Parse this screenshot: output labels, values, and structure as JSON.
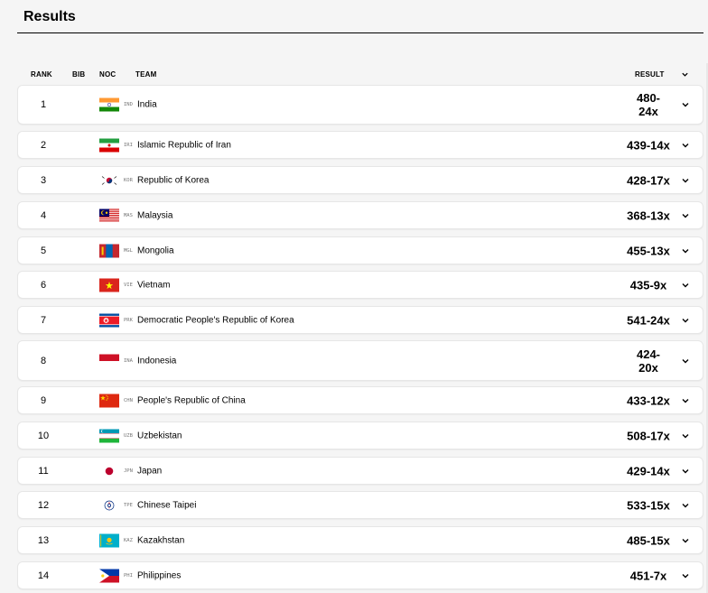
{
  "page": {
    "title": "Results"
  },
  "header": {
    "rank": "RANK",
    "bib": "BIB",
    "noc": "NOC",
    "team": "TEAM",
    "result": "RESULT"
  },
  "rows": [
    {
      "rank": "1",
      "noc": "IND",
      "team": "India",
      "result": "480-24x",
      "flag": "ind"
    },
    {
      "rank": "2",
      "noc": "IRI",
      "team": "Islamic Republic of Iran",
      "result": "439-14x",
      "flag": "iri"
    },
    {
      "rank": "3",
      "noc": "KOR",
      "team": "Republic of Korea",
      "result": "428-17x",
      "flag": "kor"
    },
    {
      "rank": "4",
      "noc": "MAS",
      "team": "Malaysia",
      "result": "368-13x",
      "flag": "mas"
    },
    {
      "rank": "5",
      "noc": "MGL",
      "team": "Mongolia",
      "result": "455-13x",
      "flag": "mgl"
    },
    {
      "rank": "6",
      "noc": "VIE",
      "team": "Vietnam",
      "result": "435-9x",
      "flag": "vie"
    },
    {
      "rank": "7",
      "noc": "PRK",
      "team": "Democratic People's Republic of Korea",
      "result": "541-24x",
      "flag": "prk"
    },
    {
      "rank": "8",
      "noc": "INA",
      "team": "Indonesia",
      "result": "424-20x",
      "flag": "ina"
    },
    {
      "rank": "9",
      "noc": "CHN",
      "team": "People's Republic of China",
      "result": "433-12x",
      "flag": "chn"
    },
    {
      "rank": "10",
      "noc": "UZB",
      "team": "Uzbekistan",
      "result": "508-17x",
      "flag": "uzb"
    },
    {
      "rank": "11",
      "noc": "JPN",
      "team": "Japan",
      "result": "429-14x",
      "flag": "jpn"
    },
    {
      "rank": "12",
      "noc": "TPE",
      "team": "Chinese Taipei",
      "result": "533-15x",
      "flag": "tpe"
    },
    {
      "rank": "13",
      "noc": "KAZ",
      "team": "Kazakhstan",
      "result": "485-15x",
      "flag": "kaz"
    },
    {
      "rank": "14",
      "noc": "PHI",
      "team": "Philippines",
      "result": "451-7x",
      "flag": "phi"
    }
  ]
}
